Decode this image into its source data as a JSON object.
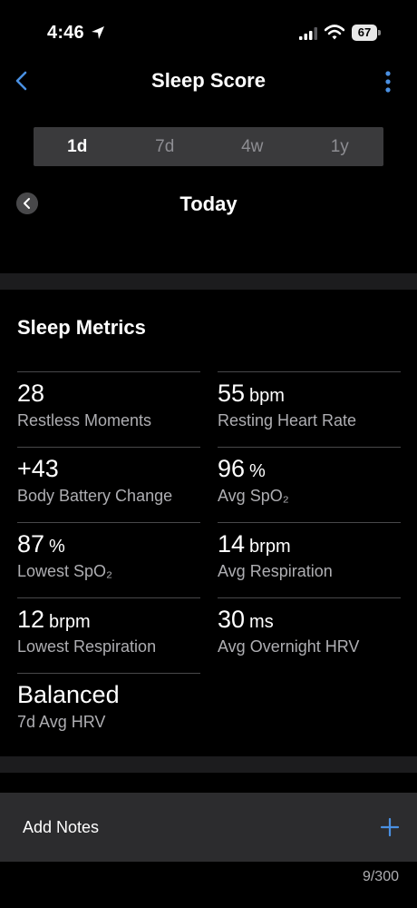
{
  "status_bar": {
    "time": "4:46",
    "battery": "67"
  },
  "header": {
    "title": "Sleep Score"
  },
  "period_tabs": [
    {
      "label": "1d",
      "active": true
    },
    {
      "label": "7d",
      "active": false
    },
    {
      "label": "4w",
      "active": false
    },
    {
      "label": "1y",
      "active": false
    }
  ],
  "date_nav": {
    "label": "Today"
  },
  "metrics": {
    "title": "Sleep Metrics",
    "items": [
      {
        "value": "28",
        "unit": "",
        "label": "Restless Moments"
      },
      {
        "value": "55",
        "unit": "bpm",
        "label": "Resting Heart Rate"
      },
      {
        "value": "+43",
        "unit": "",
        "label": "Body Battery Change"
      },
      {
        "value": "96",
        "unit": "%",
        "label": "Avg SpO₂"
      },
      {
        "value": "87",
        "unit": "%",
        "label": "Lowest SpO₂"
      },
      {
        "value": "14",
        "unit": "brpm",
        "label": "Avg Respiration"
      },
      {
        "value": "12",
        "unit": "brpm",
        "label": "Lowest Respiration"
      },
      {
        "value": "30",
        "unit": "ms",
        "label": "Avg Overnight HRV"
      },
      {
        "value": "Balanced",
        "unit": "",
        "label": "7d Avg HRV"
      }
    ]
  },
  "notes": {
    "label": "Add Notes",
    "count": "9/300"
  },
  "colors": {
    "accent": "#4a90e2",
    "background": "#000000",
    "band": "#1c1c1e",
    "tab_bg": "#3a3a3c"
  }
}
